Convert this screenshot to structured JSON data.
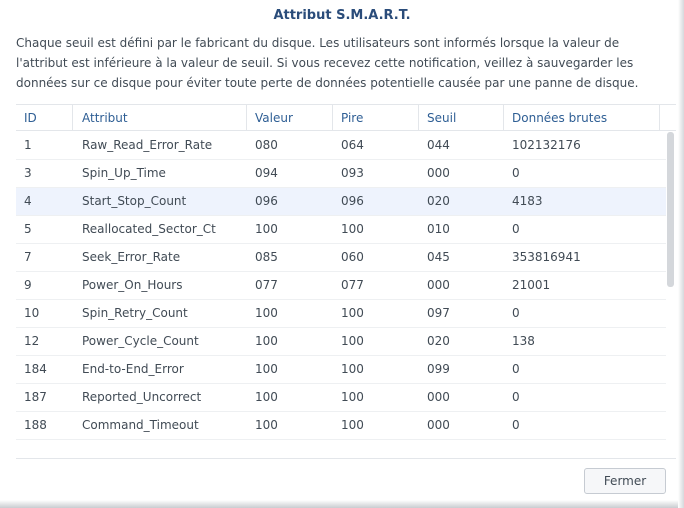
{
  "dialog": {
    "title": "Attribut S.M.A.R.T.",
    "description": "Chaque seuil est défini par le fabricant du disque. Les utilisateurs sont informés lorsque la valeur de l'attribut est inférieure à la valeur de seuil. Si vous recevez cette notification, veillez à sauvegarder les données sur ce disque pour éviter toute perte de données potentielle causée par une panne de disque.",
    "close_label": "Fermer"
  },
  "table": {
    "headers": {
      "id": "ID",
      "attribute": "Attribut",
      "value": "Valeur",
      "worst": "Pire",
      "threshold": "Seuil",
      "raw": "Données brutes"
    },
    "selected_index": 2,
    "rows": [
      {
        "id": "1",
        "attribute": "Raw_Read_Error_Rate",
        "value": "080",
        "worst": "064",
        "threshold": "044",
        "raw": "102132176"
      },
      {
        "id": "3",
        "attribute": "Spin_Up_Time",
        "value": "094",
        "worst": "093",
        "threshold": "000",
        "raw": "0"
      },
      {
        "id": "4",
        "attribute": "Start_Stop_Count",
        "value": "096",
        "worst": "096",
        "threshold": "020",
        "raw": "4183"
      },
      {
        "id": "5",
        "attribute": "Reallocated_Sector_Ct",
        "value": "100",
        "worst": "100",
        "threshold": "010",
        "raw": "0"
      },
      {
        "id": "7",
        "attribute": "Seek_Error_Rate",
        "value": "085",
        "worst": "060",
        "threshold": "045",
        "raw": "353816941"
      },
      {
        "id": "9",
        "attribute": "Power_On_Hours",
        "value": "077",
        "worst": "077",
        "threshold": "000",
        "raw": "21001"
      },
      {
        "id": "10",
        "attribute": "Spin_Retry_Count",
        "value": "100",
        "worst": "100",
        "threshold": "097",
        "raw": "0"
      },
      {
        "id": "12",
        "attribute": "Power_Cycle_Count",
        "value": "100",
        "worst": "100",
        "threshold": "020",
        "raw": "138"
      },
      {
        "id": "184",
        "attribute": "End-to-End_Error",
        "value": "100",
        "worst": "100",
        "threshold": "099",
        "raw": "0"
      },
      {
        "id": "187",
        "attribute": "Reported_Uncorrect",
        "value": "100",
        "worst": "100",
        "threshold": "000",
        "raw": "0"
      },
      {
        "id": "188",
        "attribute": "Command_Timeout",
        "value": "100",
        "worst": "100",
        "threshold": "000",
        "raw": "0"
      }
    ]
  }
}
